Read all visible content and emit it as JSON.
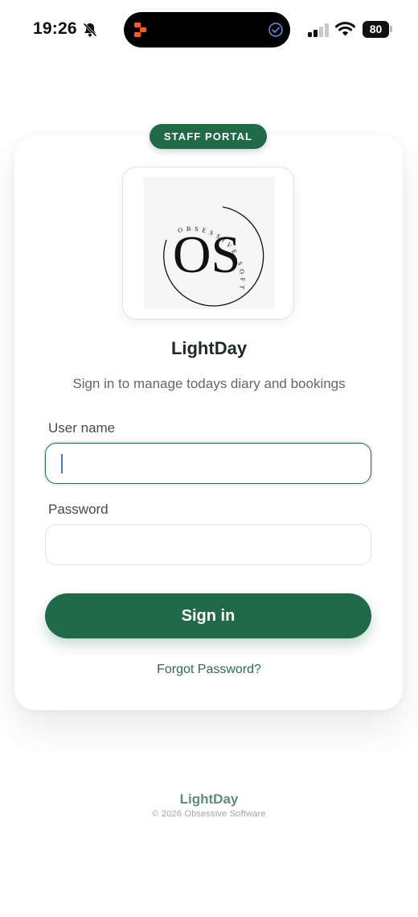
{
  "status_bar": {
    "time": "19:26",
    "battery": "80",
    "icons": [
      "bell-slash-icon",
      "signal-icon",
      "wifi-icon",
      "battery-icon"
    ],
    "island_icons": [
      "app-activity-icon",
      "check-circle-icon"
    ]
  },
  "badge": {
    "label": "STAFF PORTAL"
  },
  "logo": {
    "monogram": "OS",
    "ring_text": "OBSESSIVE SOFTWARE"
  },
  "app": {
    "title": "LightDay",
    "subtitle": "Sign in to manage todays diary and bookings"
  },
  "form": {
    "username_label": "User name",
    "username_value": "",
    "username_placeholder": "",
    "password_label": "Password",
    "password_value": "",
    "password_placeholder": "",
    "submit_label": "Sign in",
    "forgot_label": "Forgot Password?"
  },
  "footer": {
    "brand": "LightDay",
    "copyright": "© 2026 Obsessive Software"
  },
  "colors": {
    "accent": "#1f6b48",
    "footer_brand": "#5e8d76",
    "island_icon": "#ff5a1f"
  }
}
